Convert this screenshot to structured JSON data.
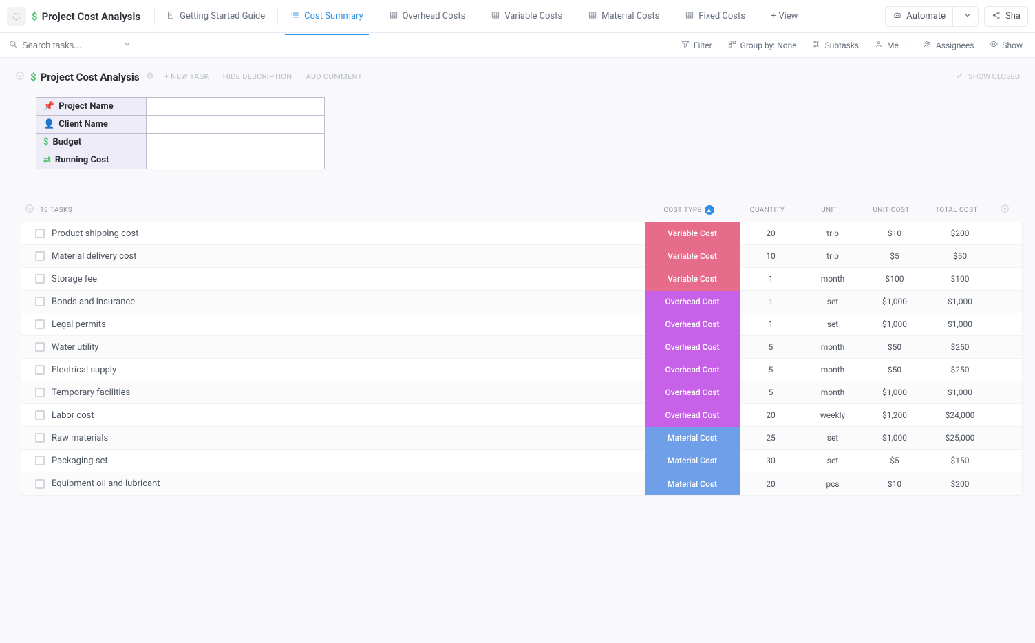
{
  "header": {
    "project_title": "Project Cost Analysis",
    "tabs": [
      {
        "id": "getting-started",
        "label": "Getting Started Guide",
        "icon": "doc",
        "active": false
      },
      {
        "id": "cost-summary",
        "label": "Cost Summary",
        "icon": "list",
        "active": true
      },
      {
        "id": "overhead-costs",
        "label": "Overhead Costs",
        "icon": "grid",
        "active": false
      },
      {
        "id": "variable-costs",
        "label": "Variable Costs",
        "icon": "grid",
        "active": false
      },
      {
        "id": "material-costs",
        "label": "Material Costs",
        "icon": "grid",
        "active": false
      },
      {
        "id": "fixed-costs",
        "label": "Fixed Costs",
        "icon": "grid",
        "active": false
      }
    ],
    "add_view_label": "View",
    "automate_label": "Automate",
    "share_label": "Sha"
  },
  "filterbar": {
    "search_placeholder": "Search tasks...",
    "filter_label": "Filter",
    "group_by_label": "Group by: None",
    "subtasks_label": "Subtasks",
    "me_label": "Me",
    "assignees_label": "Assignees",
    "show_label": "Show"
  },
  "page": {
    "title": "Project Cost Analysis",
    "new_task_label": "+ NEW TASK",
    "hide_desc_label": "HIDE DESCRIPTION",
    "add_comment_label": "ADD COMMENT",
    "show_closed_label": "SHOW CLOSED"
  },
  "summary": {
    "rows": [
      {
        "icon": "pin",
        "label": "Project Name",
        "value": ""
      },
      {
        "icon": "client",
        "label": "Client Name",
        "value": ""
      },
      {
        "icon": "dollar",
        "label": "Budget",
        "value": ""
      },
      {
        "icon": "arrows",
        "label": "Running Cost",
        "value": ""
      }
    ]
  },
  "tasks": {
    "count_label": "16 TASKS",
    "columns": {
      "cost_type": "COST TYPE",
      "quantity": "QUANTITY",
      "unit": "UNIT",
      "unit_cost": "UNIT COST",
      "total_cost": "TOTAL COST"
    },
    "rows": [
      {
        "name": "Product shipping cost",
        "cost_type": "Variable Cost",
        "badge": "Variable",
        "quantity": "20",
        "unit": "trip",
        "unit_cost": "$10",
        "total_cost": "$200"
      },
      {
        "name": "Material delivery cost",
        "cost_type": "Variable Cost",
        "badge": "Variable",
        "quantity": "10",
        "unit": "trip",
        "unit_cost": "$5",
        "total_cost": "$50"
      },
      {
        "name": "Storage fee",
        "cost_type": "Variable Cost",
        "badge": "Variable",
        "quantity": "1",
        "unit": "month",
        "unit_cost": "$100",
        "total_cost": "$100"
      },
      {
        "name": "Bonds and insurance",
        "cost_type": "Overhead Cost",
        "badge": "Overhead",
        "quantity": "1",
        "unit": "set",
        "unit_cost": "$1,000",
        "total_cost": "$1,000"
      },
      {
        "name": "Legal permits",
        "cost_type": "Overhead Cost",
        "badge": "Overhead",
        "quantity": "1",
        "unit": "set",
        "unit_cost": "$1,000",
        "total_cost": "$1,000"
      },
      {
        "name": "Water utility",
        "cost_type": "Overhead Cost",
        "badge": "Overhead",
        "quantity": "5",
        "unit": "month",
        "unit_cost": "$50",
        "total_cost": "$250"
      },
      {
        "name": "Electrical supply",
        "cost_type": "Overhead Cost",
        "badge": "Overhead",
        "quantity": "5",
        "unit": "month",
        "unit_cost": "$50",
        "total_cost": "$250"
      },
      {
        "name": "Temporary facilities",
        "cost_type": "Overhead Cost",
        "badge": "Overhead",
        "quantity": "5",
        "unit": "month",
        "unit_cost": "$1,000",
        "total_cost": "$1,000"
      },
      {
        "name": "Labor cost",
        "cost_type": "Overhead Cost",
        "badge": "Overhead",
        "quantity": "20",
        "unit": "weekly",
        "unit_cost": "$1,200",
        "total_cost": "$24,000"
      },
      {
        "name": "Raw materials",
        "cost_type": "Material Cost",
        "badge": "Material",
        "quantity": "25",
        "unit": "set",
        "unit_cost": "$1,000",
        "total_cost": "$25,000"
      },
      {
        "name": "Packaging set",
        "cost_type": "Material Cost",
        "badge": "Material",
        "quantity": "30",
        "unit": "set",
        "unit_cost": "$5",
        "total_cost": "$150"
      },
      {
        "name": "Equipment oil and lubricant",
        "cost_type": "Material Cost",
        "badge": "Material",
        "quantity": "20",
        "unit": "pcs",
        "unit_cost": "$10",
        "total_cost": "$200"
      }
    ]
  }
}
